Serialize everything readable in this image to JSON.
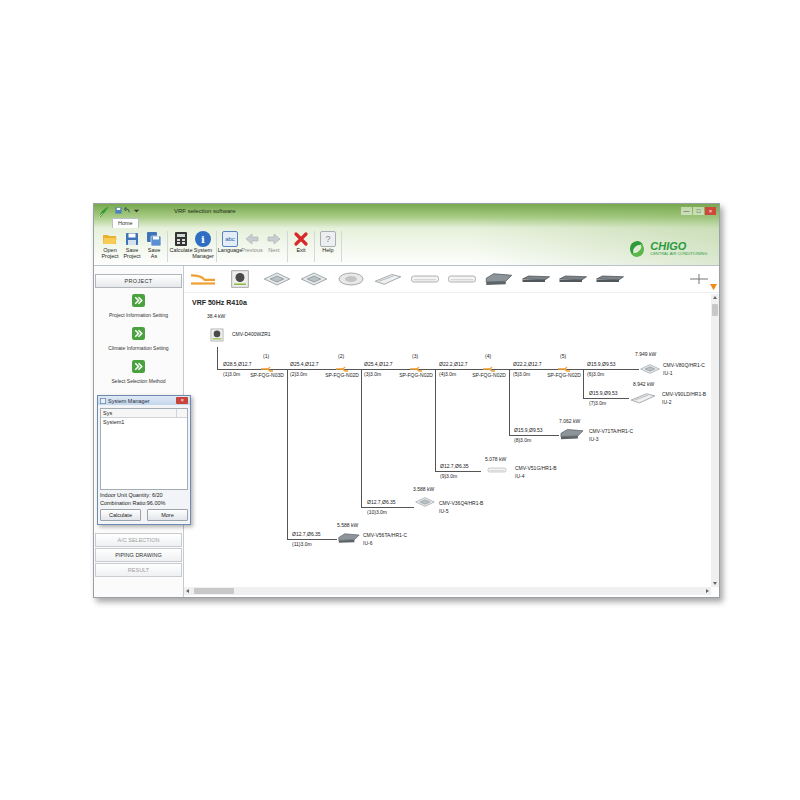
{
  "window": {
    "title": "VRF selection software",
    "controls": [
      "—",
      "□",
      "×"
    ]
  },
  "ribbon_tabs": [
    {
      "label": "Home",
      "selected": true
    }
  ],
  "toolbar": [
    [
      {
        "label": "Open Project",
        "kind": "open",
        "disabled": false
      },
      {
        "label": "Save Project",
        "kind": "save",
        "disabled": false
      },
      {
        "label": "Save As",
        "kind": "save-as",
        "disabled": false
      }
    ],
    [
      {
        "label": "Calculate",
        "kind": "calculate",
        "disabled": false
      },
      {
        "label": "System Manager",
        "kind": "info",
        "glyph": "i",
        "disabled": false
      }
    ],
    [
      {
        "label": "Language",
        "kind": "language",
        "glyph": "abc",
        "disabled": false
      },
      {
        "label": "Previous",
        "kind": "previous",
        "disabled": true
      },
      {
        "label": "Next",
        "kind": "next",
        "disabled": true
      }
    ],
    [
      {
        "label": "Exit",
        "kind": "exit",
        "disabled": false
      }
    ],
    [
      {
        "label": "Help",
        "kind": "help",
        "glyph": "?",
        "disabled": false
      }
    ]
  ],
  "brand": {
    "name": "CHIGO",
    "tagline": "CENTRAL AIR CONDITIONING"
  },
  "sidebar": {
    "header": "PROJECT",
    "steps": [
      "Project Information Setting",
      "Climate Information Setting",
      "Select Selection Method"
    ],
    "sections": [
      {
        "label": "A/C SELECTION",
        "disabled": true
      },
      {
        "label": "PIPING DRAWING",
        "disabled": false
      },
      {
        "label": "RESULT",
        "disabled": true
      }
    ]
  },
  "palette": [
    {
      "kind": "joint"
    },
    {
      "kind": "outdoor"
    },
    {
      "kind": "cassette"
    },
    {
      "kind": "cassette"
    },
    {
      "kind": "round"
    },
    {
      "kind": "ceiling"
    },
    {
      "kind": "wall"
    },
    {
      "kind": "wall"
    },
    {
      "kind": "duct"
    },
    {
      "kind": "slim"
    },
    {
      "kind": "slim"
    },
    {
      "kind": "slim"
    }
  ],
  "diagram": {
    "title": "VRF 50Hz R410a",
    "outdoor": {
      "capacity": "38.4 kW",
      "model": "CMV-D400WZR1"
    },
    "trunk": [
      {
        "size": "Ø28.5,Ø12.7",
        "length": "(1)3.0m"
      },
      {
        "size": "Ø25.4,Ø12.7",
        "length": "(2)3.0m"
      },
      {
        "size": "Ø25.4,Ø12.7",
        "length": "(3)3.0m"
      },
      {
        "size": "Ø22.2,Ø12.7",
        "length": "(4)3.0m"
      },
      {
        "size": "Ø22.2,Ø12.7",
        "length": "(5)3.0m"
      }
    ],
    "joints": [
      {
        "number": "(1)",
        "model": "SP-FQG-N03D"
      },
      {
        "number": "(2)",
        "model": "SP-FQG-N02D"
      },
      {
        "number": "(3)",
        "model": "SP-FQG-N02D"
      },
      {
        "number": "(4)",
        "model": "SP-FQG-N02D"
      },
      {
        "number": "(5)",
        "model": "SP-FQG-N02D"
      }
    ],
    "indoor_units": [
      {
        "id": "IU-1",
        "capacity": "7.949 kW",
        "model": "CMV-V80Q/HR1-C",
        "kind": "cassette",
        "size": "Ø15.9,Ø9.53",
        "length": "(6)3.0m"
      },
      {
        "id": "IU-2",
        "capacity": "8.942 kW",
        "model": "CMV-V90LD/HR1-B",
        "kind": "ceiling",
        "size": "Ø15.9,Ø9.53",
        "length": "(7)3.0m"
      },
      {
        "id": "IU-3",
        "capacity": "7.062 kW",
        "model": "CMV-V71TA/HR1-C",
        "kind": "duct",
        "size": "Ø15.9,Ø9.53",
        "length": "(8)3.0m"
      },
      {
        "id": "IU-4",
        "capacity": "5.078 kW",
        "model": "CMV-V51G/HR1-B",
        "kind": "wall",
        "size": "Ø12.7,Ø6.35",
        "length": "(9)3.0m"
      },
      {
        "id": "IU-5",
        "capacity": "3.588 kW",
        "model": "CMV-V36Q4/HR1-B",
        "kind": "cassette",
        "size": "Ø12.7,Ø6.35",
        "length": "(10)3.0m"
      },
      {
        "id": "IU-6",
        "capacity": "5.588 kW",
        "model": "CMV-V56TA/HR1-C",
        "kind": "duct",
        "size": "Ø12.7,Ø6.35",
        "length": "(11)3.0m"
      }
    ]
  },
  "system_manager": {
    "title": "System Manager",
    "close": "×",
    "column": "Sys",
    "rows": [
      {
        "label": "System1",
        "selected": false
      }
    ],
    "quantity": "Indoor Unit Quantity: 6/20",
    "ratio": "Combination Ratio:96.00%",
    "buttons": [
      "Calculate",
      "More"
    ]
  }
}
